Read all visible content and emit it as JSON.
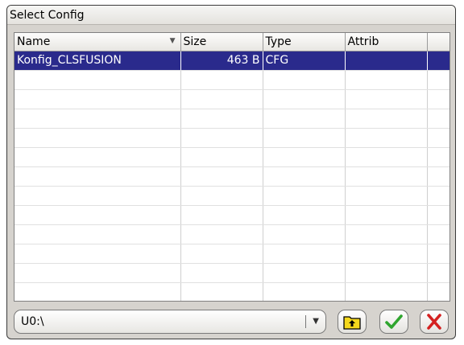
{
  "window": {
    "title": "Select Config"
  },
  "table": {
    "columns": [
      {
        "label": "Name"
      },
      {
        "label": "Size"
      },
      {
        "label": "Type"
      },
      {
        "label": "Attrib"
      },
      {
        "label": ""
      }
    ],
    "rows": [
      {
        "name": "Konfig_CLSFUSION",
        "size": "463 B",
        "type": "CFG",
        "attrib": "",
        "extra": "",
        "selected": true
      }
    ],
    "empty_rows": 12
  },
  "footer": {
    "path_value": "U0:\\",
    "up_folder_icon": "folder-up-icon",
    "ok_icon": "checkmark-icon",
    "cancel_icon": "x-icon"
  },
  "colors": {
    "selection": "#2a2a8c",
    "ok_green": "#2fa52f",
    "cancel_red": "#d42020"
  }
}
